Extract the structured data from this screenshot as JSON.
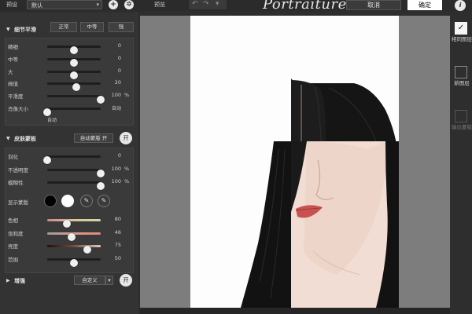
{
  "topbar": {
    "preset_label": "预设",
    "preset_value": "默认",
    "add_icon": "plus-icon",
    "settings_icon": "gear-icon",
    "preview_label": "预览",
    "brand": "Portraiture® 3",
    "cancel_label": "取消",
    "ok_label": "确定",
    "info_label": "i"
  },
  "detail_smoothing": {
    "title": "细节平滑",
    "modes": [
      "正常",
      "中等",
      "强"
    ],
    "sliders": [
      {
        "label": "精细",
        "value": 0,
        "unit": "",
        "fraction": 0.5
      },
      {
        "label": "中等",
        "value": 0,
        "unit": "",
        "fraction": 0.5
      },
      {
        "label": "大",
        "value": 0,
        "unit": "",
        "fraction": 0.5
      },
      {
        "label": "阀值",
        "value": 20,
        "unit": "",
        "fraction": 0.55
      },
      {
        "label": "平滑度",
        "value": 100,
        "unit": "%",
        "fraction": 1.0
      }
    ],
    "size_label": "肖像大小",
    "size_auto_right": "自动",
    "size_auto_bottom": "自动"
  },
  "skin_mask": {
    "title": "皮肤蒙板",
    "auto_mask_label": "自动蒙版 开",
    "toggle_label": "开",
    "sliders": [
      {
        "label": "羽化",
        "value": 0,
        "unit": "",
        "fraction": 0.0
      },
      {
        "label": "不透明度",
        "value": 100,
        "unit": "%",
        "fraction": 1.0
      },
      {
        "label": "模糊性",
        "value": 100,
        "unit": "%",
        "fraction": 1.0
      }
    ],
    "show_mask_label": "显示蒙版",
    "swatch_colors": [
      "#000000",
      "#ffffff"
    ],
    "pick_icons": [
      "eyedropper-icon",
      "eyedropper-plus-icon"
    ],
    "color_sliders": [
      {
        "label": "色相",
        "value": 80,
        "unit": "",
        "fraction": 0.37
      },
      {
        "label": "饱和度",
        "value": 46,
        "unit": "",
        "fraction": 0.45
      },
      {
        "label": "亮度",
        "value": 75,
        "unit": "",
        "fraction": 0.75
      },
      {
        "label": "范围",
        "value": 50,
        "unit": "",
        "fraction": 0.5
      }
    ]
  },
  "enhance": {
    "title": "增强",
    "preset_label": "自定义",
    "toggle_label": "开"
  },
  "right_panel": {
    "items": [
      {
        "label": "相同图层",
        "checked": true
      },
      {
        "label": "新图层",
        "checked": false
      },
      {
        "label": "输出蒙版",
        "checked": false,
        "disabled": true
      }
    ]
  }
}
